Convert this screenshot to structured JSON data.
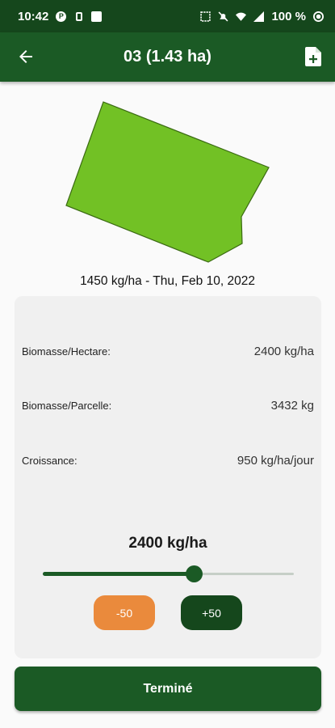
{
  "status_bar": {
    "time": "10:42",
    "battery": "100 %",
    "icons": [
      "notification-icon",
      "phone-icon",
      "image-icon",
      "network-icon",
      "mute-icon",
      "wifi-icon",
      "signal-icon",
      "battery-icon"
    ]
  },
  "app_bar": {
    "title": "03 (1.43 ha)",
    "back_icon": "arrow-back-icon",
    "action_icon": "file-add-icon"
  },
  "parcel": {
    "fill_color": "#72c125",
    "border_color": "#3a6a12",
    "caption": "1450 kg/ha - Thu, Feb 10, 2022"
  },
  "stats": [
    {
      "label": "Biomasse/Hectare:",
      "value": "2400 kg/ha"
    },
    {
      "label": "Biomasse/Parcelle:",
      "value": "3432 kg"
    },
    {
      "label": "Croissance:",
      "value": "950 kg/ha/jour"
    }
  ],
  "adjuster": {
    "current_value": "2400 kg/ha",
    "slider_fraction": 0.6,
    "minus_label": "-50",
    "plus_label": "+50"
  },
  "colors": {
    "primary": "#1b5a25",
    "status_bar": "#15471c",
    "minus_button": "#ea8a3c",
    "plus_button": "#15471c"
  },
  "done_label": "Terminé"
}
